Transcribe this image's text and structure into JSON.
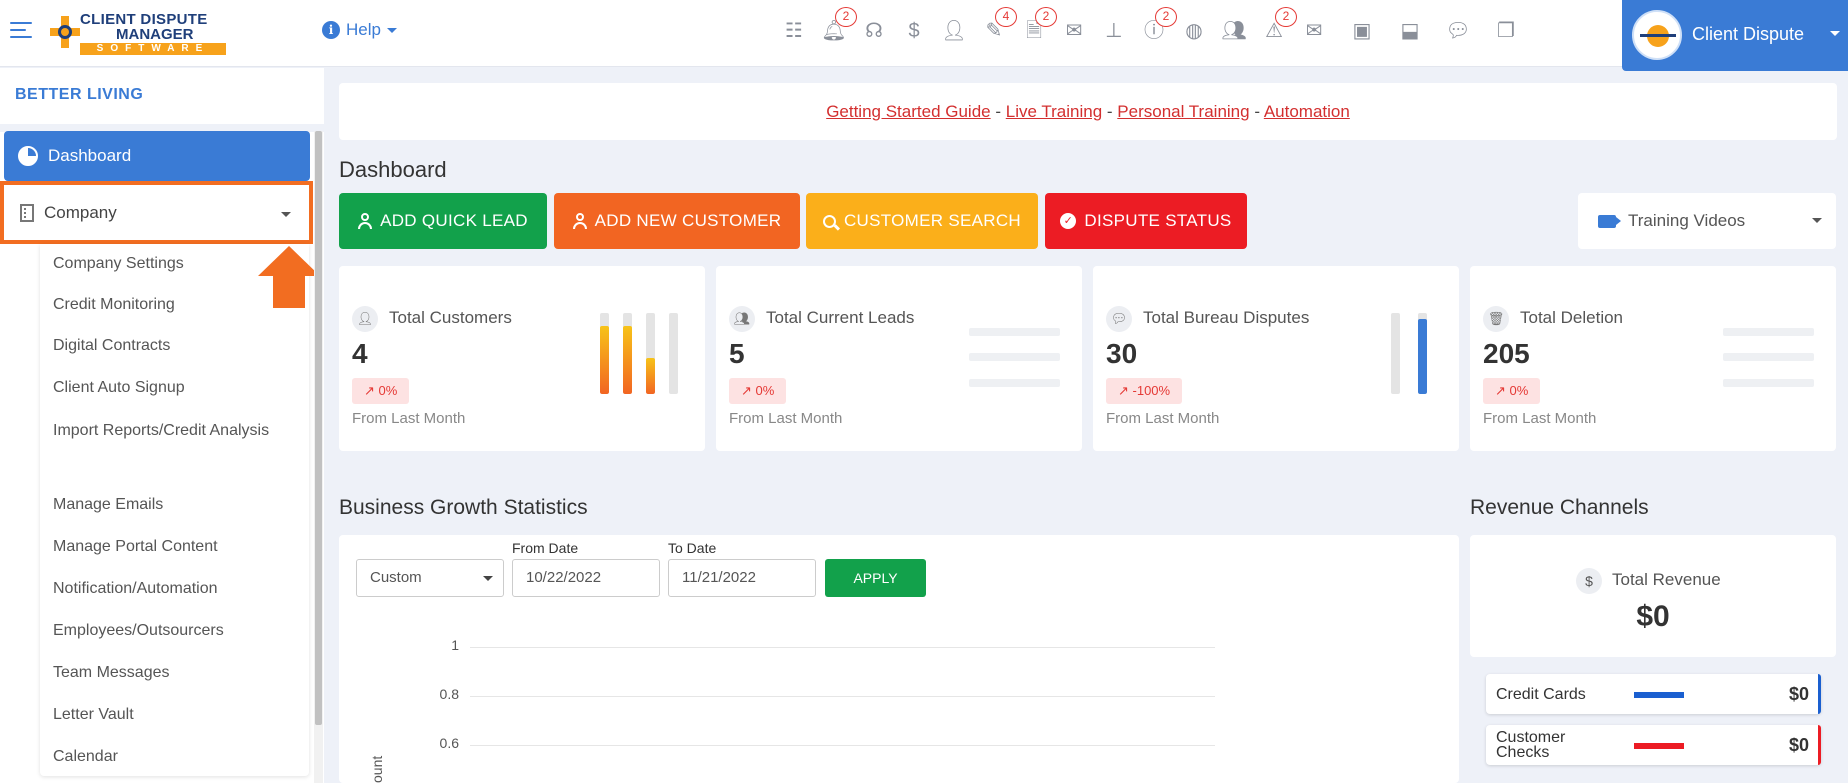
{
  "header": {
    "logo_line1": "CLIENT DISPUTE",
    "logo_line2": "MANAGER",
    "logo_line3": "SOFTWARE",
    "help_label": "Help",
    "user_name": "Client Dispute",
    "icons": [
      {
        "name": "tasks-icon",
        "glyph": "☷",
        "badge": ""
      },
      {
        "name": "bell-icon",
        "glyph": "🔔︎",
        "badge": "2"
      },
      {
        "name": "support-icon",
        "glyph": "☊",
        "badge": ""
      },
      {
        "name": "dollar-icon",
        "glyph": "$",
        "badge": ""
      },
      {
        "name": "user-tie-icon",
        "glyph": "👤︎",
        "badge": ""
      },
      {
        "name": "pen-icon",
        "glyph": "✎",
        "badge": "4"
      },
      {
        "name": "document-icon",
        "glyph": "🗎",
        "badge": "2"
      },
      {
        "name": "mail-icon",
        "glyph": "✉",
        "badge": ""
      },
      {
        "name": "org-chart-icon",
        "glyph": "⊥",
        "badge": ""
      },
      {
        "name": "info-icon",
        "glyph": "ⓘ",
        "badge": "2"
      },
      {
        "name": "globe-icon",
        "glyph": "◍",
        "badge": ""
      },
      {
        "name": "users-icon",
        "glyph": "👥︎",
        "badge": ""
      },
      {
        "name": "warning-icon",
        "glyph": "⚠",
        "badge": "2"
      },
      {
        "name": "mail-open-icon",
        "glyph": "✉",
        "badge": ""
      },
      {
        "name": "money-icon",
        "glyph": "▣",
        "badge": ""
      },
      {
        "name": "inbox-icon",
        "glyph": "⬓",
        "badge": ""
      },
      {
        "name": "chat-icon",
        "glyph": "💬︎",
        "badge": ""
      },
      {
        "name": "copy-icon",
        "glyph": "❐",
        "badge": ""
      }
    ]
  },
  "sidebar": {
    "org_name": "BETTER LIVING",
    "dashboard_label": "Dashboard",
    "company_label": "Company",
    "submenu": [
      "Company Settings",
      "Credit Monitoring",
      "Digital Contracts",
      "Client Auto Signup",
      "Import Reports/Credit Analysis",
      "Manage Emails",
      "Manage Portal Content",
      "Notification/Automation",
      "Employees/Outsourcers",
      "Team Messages",
      "Letter Vault",
      "Calendar"
    ]
  },
  "links_bar": {
    "getting_started": "Getting Started Guide",
    "live_training": "Live Training",
    "personal_training": "Personal Training",
    "automation": "Automation",
    "separator": "-"
  },
  "main": {
    "title": "Dashboard",
    "buttons": {
      "quick_lead": "ADD QUICK LEAD",
      "new_customer": "ADD NEW CUSTOMER",
      "customer_search": "CUSTOMER SEARCH",
      "dispute_status": "DISPUTE STATUS"
    },
    "training_videos": "Training Videos",
    "cards": [
      {
        "label": "Total Customers",
        "value": "4",
        "change": "0%",
        "from": "From Last Month"
      },
      {
        "label": "Total Current Leads",
        "value": "5",
        "change": "0%",
        "from": "From Last Month"
      },
      {
        "label": "Total Bureau Disputes",
        "value": "30",
        "change": "-100%",
        "from": "From Last Month"
      },
      {
        "label": "Total Deletion",
        "value": "205",
        "change": "0%",
        "from": "From Last Month"
      }
    ],
    "card_bar_levels": {
      "customers": [
        0.84,
        0.84,
        0.45,
        0.0
      ],
      "disputes": [
        0.0,
        0.92
      ]
    }
  },
  "growth": {
    "title": "Business Growth Statistics",
    "range_select": "Custom",
    "from_label": "From Date",
    "from_value": "10/22/2022",
    "to_label": "To Date",
    "to_value": "11/21/2022",
    "apply_label": "APPLY",
    "y_ticks": [
      "1",
      "0.8",
      "0.6"
    ],
    "y_axis_label": "ount"
  },
  "revenue": {
    "title": "Revenue Channels",
    "total_label": "Total Revenue",
    "total_value": "$0",
    "channels": [
      {
        "name": "Credit Cards",
        "amount": "$0",
        "color": "#1a5fd0"
      },
      {
        "name": "Customer Checks",
        "amount": "$0",
        "color": "#ec1c24"
      }
    ]
  },
  "colors": {
    "primary": "#3a7bd5",
    "green": "#12a14b",
    "orange": "#f26522",
    "yellow": "#fbaf1a",
    "red": "#ec1c24",
    "highlight": "#f26d21"
  }
}
